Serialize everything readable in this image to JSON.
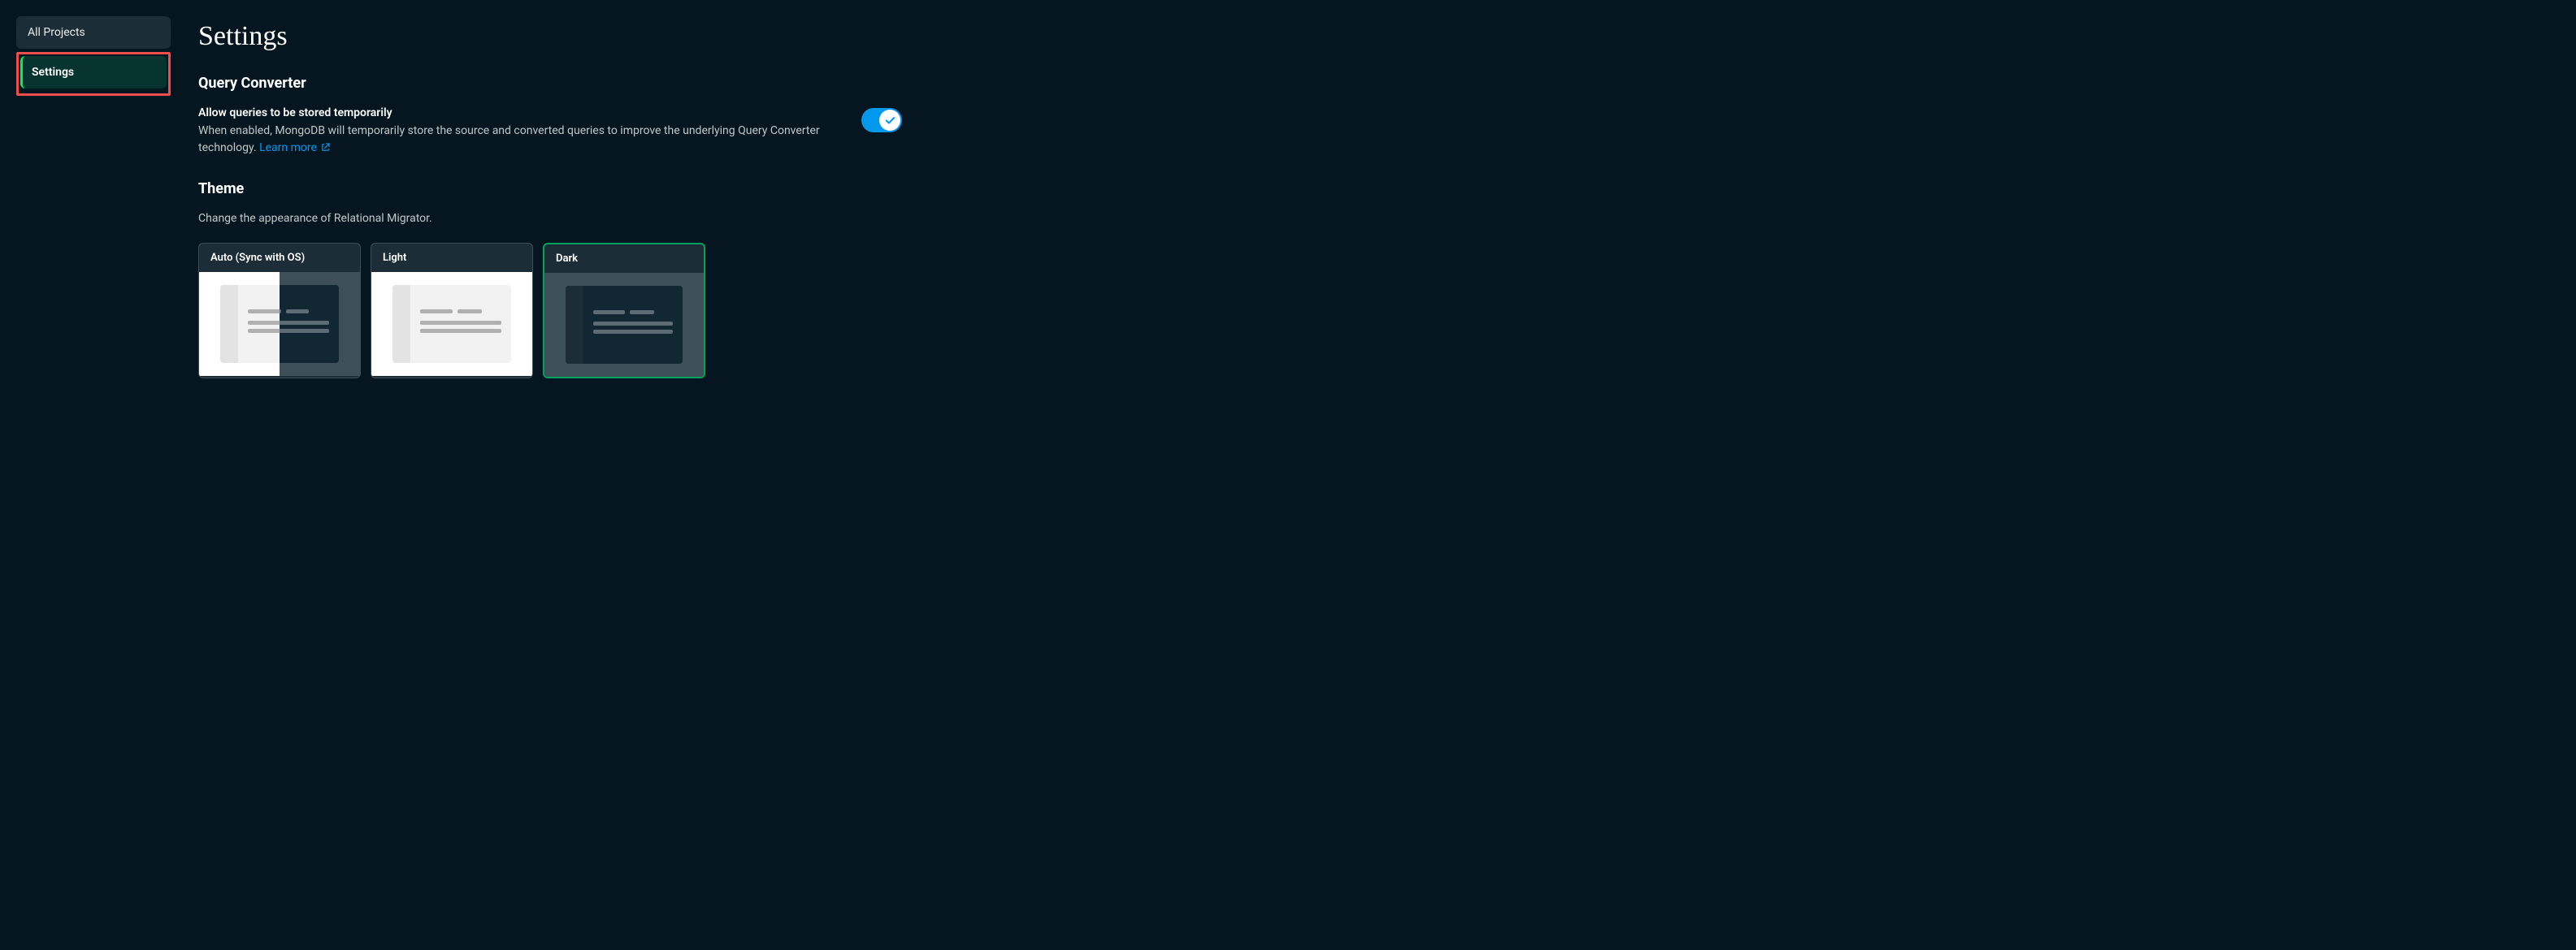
{
  "sidebar": {
    "items": [
      {
        "label": "All Projects"
      },
      {
        "label": "Settings"
      }
    ]
  },
  "page": {
    "title": "Settings"
  },
  "query_converter": {
    "section_title": "Query Converter",
    "setting_label": "Allow queries to be stored temporarily",
    "setting_desc": "When enabled, MongoDB will temporarily store the source and converted queries to improve the underlying Query Converter technology. ",
    "learn_more": "Learn more",
    "toggle_on": true
  },
  "theme": {
    "section_title": "Theme",
    "subtext": "Change the appearance of Relational Migrator.",
    "options": [
      {
        "label": "Auto (Sync with OS)"
      },
      {
        "label": "Light"
      },
      {
        "label": "Dark"
      }
    ],
    "selected": "Dark"
  }
}
